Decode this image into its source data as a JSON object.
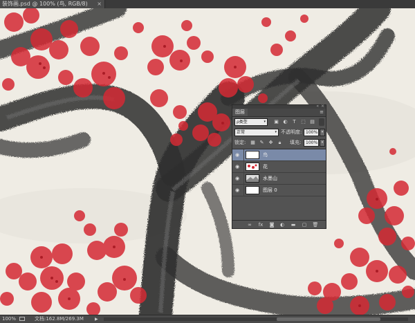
{
  "document": {
    "tab_title": "装饰画.psd @ 100% (鸟, RGB/8)",
    "close_glyph": "×"
  },
  "status": {
    "zoom": "100%",
    "doc_info": "文档:162.8M/269.3M",
    "arrow": "▶"
  },
  "layers_panel": {
    "collapse_glyph": "«",
    "close_glyph": "×",
    "tab_label": "图层",
    "menu_glyph": "≡",
    "filter_kind": "ρ类型",
    "dropdown_glyph": "▾",
    "blend_mode": "正常",
    "opacity_label": "不透明度:",
    "opacity_value": "100%",
    "lock_label": "锁定:",
    "fill_label": "填充:",
    "fill_value": "100%",
    "eye_glyph": "◉",
    "layers": [
      {
        "name": "鸟",
        "selected": true
      },
      {
        "name": "花",
        "selected": false
      },
      {
        "name": "水墨山",
        "selected": false
      },
      {
        "name": "图层 0",
        "selected": false
      }
    ],
    "bottom_icons": [
      "link-icon",
      "fx-icon",
      "mask-icon",
      "adjustment-icon",
      "group-icon",
      "new-layer-icon",
      "trash-icon"
    ]
  },
  "colors": {
    "blossom": "#d42a34",
    "ink": "#2a2a2a",
    "paper": "#efece4",
    "selected_layer": "#7a8aa8"
  }
}
